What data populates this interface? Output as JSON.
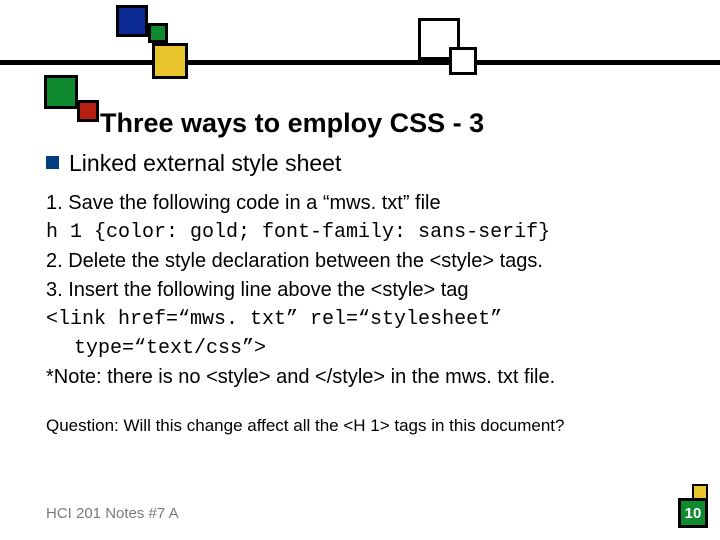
{
  "title": "Three ways to employ CSS - 3",
  "sub": "Linked external style sheet",
  "steps": {
    "s1": "1. Save the following code in a “mws. txt” file",
    "code1": "h 1 {color: gold; font-family: sans-serif}",
    "s2": "2. Delete the style declaration between the <style> tags.",
    "s3": "3. Insert the following line above the <style> tag",
    "code2a": "<link href=“mws. txt” rel=“stylesheet”",
    "code2b": "type=“text/css”>",
    "note": "*Note: there is no <style> and </style> in the mws. txt file."
  },
  "question": "Question: Will this change affect all the <H 1> tags in this document?",
  "footer": "HCI 201 Notes #7 A",
  "page": "10",
  "decor": {
    "blue": "#0b2a94",
    "green": "#108a2e",
    "yellow": "#e8c52a",
    "red": "#b51f14"
  }
}
